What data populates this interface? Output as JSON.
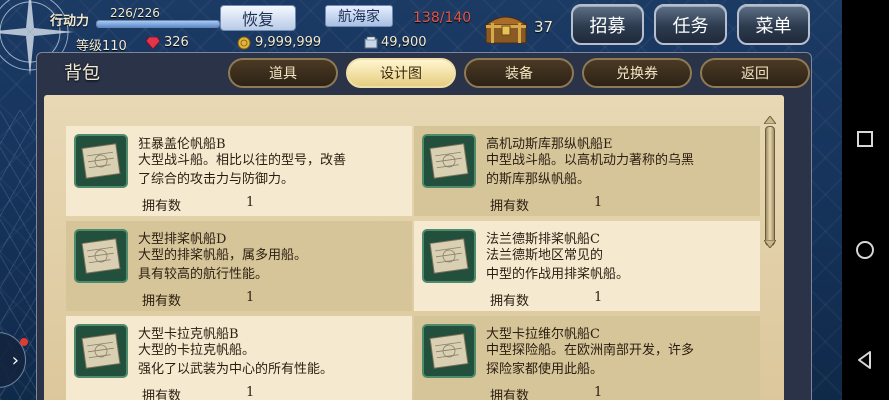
{
  "hud": {
    "stamina_label": "行动力",
    "stamina_value": "226/226",
    "stamina_fraction": 1.0,
    "restore_label": "恢复",
    "job_label": "航海家",
    "cargo": "138/140",
    "chest_count": "37",
    "level": "等级110",
    "gems": "326",
    "gold": "9,999,999",
    "bars": "49,900"
  },
  "top_buttons": [
    "招募",
    "任务",
    "菜单"
  ],
  "panel_title": "背包",
  "tabs": [
    {
      "label": "道具",
      "active": false
    },
    {
      "label": "设计图",
      "active": true
    },
    {
      "label": "装备",
      "active": false
    },
    {
      "label": "兑换券",
      "active": false
    },
    {
      "label": "返回",
      "active": false
    }
  ],
  "owned_label": "拥有数",
  "items": [
    {
      "name": "狂暴盖伦帆船B",
      "desc": "大型战斗船。相比以往的型号，改善\n了综合的攻击力与防御力。",
      "count": "1"
    },
    {
      "name": "高机动斯库那纵帆船E",
      "desc": "中型战斗船。以高机动力著称的乌黑\n的斯库那纵帆船。",
      "count": "1"
    },
    {
      "name": "大型排桨帆船D",
      "desc": "大型的排桨帆船，属多用船。\n具有较高的航行性能。",
      "count": "1"
    },
    {
      "name": "法兰德斯排桨帆船C",
      "desc": "法兰德斯地区常见的\n中型的作战用排桨帆船。",
      "count": "1"
    },
    {
      "name": "大型卡拉克帆船B",
      "desc": "大型的卡拉克帆船。\n强化了以武装为中心的所有性能。",
      "count": "1"
    },
    {
      "name": "大型卡拉维尔帆船C",
      "desc": "中型探险船。在欧洲南部开发，许多\n探险家都使用此船。",
      "count": "1"
    }
  ],
  "icons": {
    "chest": "treasure-chest-icon",
    "gem": "gem-icon",
    "coin": "gold-coin-icon",
    "bar": "silver-bar-icon",
    "blueprint": "blueprint-scroll-icon",
    "compass": "compass-rose-icon"
  },
  "colors": {
    "cargo_red": "#e0574a",
    "active_tab": "#e6cd82",
    "parchment": "#e8d8b4",
    "card_light": "#f5ead0",
    "card_dark": "#d7c59a"
  }
}
